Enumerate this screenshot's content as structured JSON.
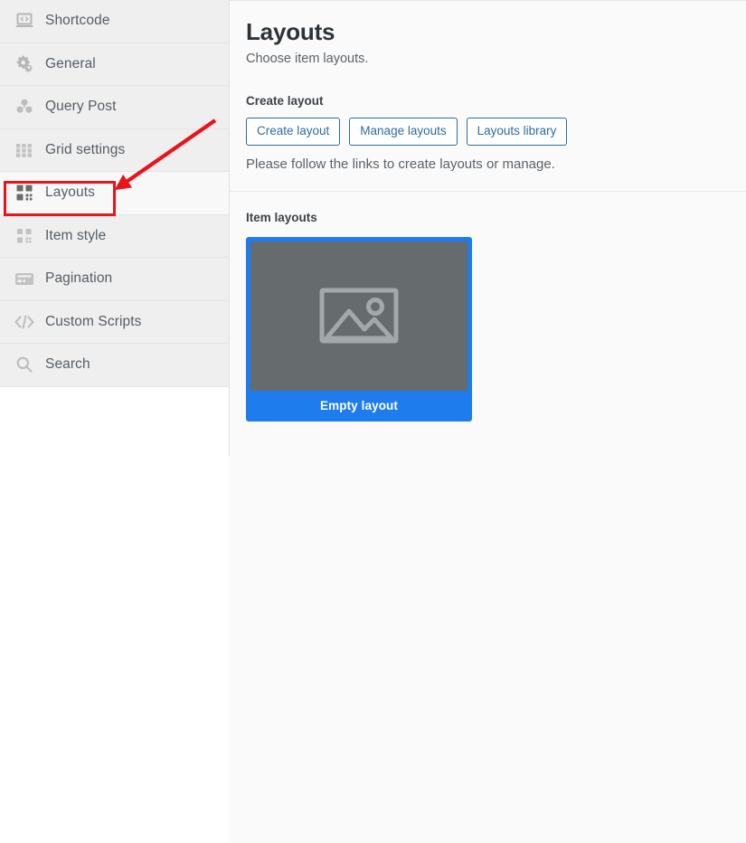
{
  "sidebar": {
    "items": [
      {
        "label": "Shortcode",
        "icon": "shortcode-icon",
        "active": false
      },
      {
        "label": "General",
        "icon": "gears-icon",
        "active": false
      },
      {
        "label": "Query Post",
        "icon": "query-post-icon",
        "active": false
      },
      {
        "label": "Grid settings",
        "icon": "grid-settings-icon",
        "active": false
      },
      {
        "label": "Layouts",
        "icon": "layouts-icon",
        "active": true
      },
      {
        "label": "Item style",
        "icon": "item-style-icon",
        "active": false
      },
      {
        "label": "Pagination",
        "icon": "pagination-icon",
        "active": false
      },
      {
        "label": "Custom Scripts",
        "icon": "code-icon",
        "active": false
      },
      {
        "label": "Search",
        "icon": "search-icon",
        "active": false
      }
    ]
  },
  "main": {
    "title": "Layouts",
    "subtitle": "Choose item layouts.",
    "create_layout": {
      "label": "Create layout",
      "buttons": [
        {
          "label": "Create layout"
        },
        {
          "label": "Manage layouts"
        },
        {
          "label": "Layouts library"
        }
      ],
      "help": "Please follow the links to create layouts or manage."
    },
    "item_layouts": {
      "label": "Item layouts",
      "cards": [
        {
          "caption": "Empty layout",
          "thumb_icon": "image-placeholder-icon",
          "selected": true
        }
      ]
    }
  },
  "annotations": {
    "highlight_target": "Layouts",
    "arrow_color": "#e8141a",
    "box_color": "#e8141a"
  },
  "colors": {
    "sidebar_bg": "#efefef",
    "sidebar_active_bg": "#f8f8f8",
    "main_bg": "#fafafa",
    "accent_blue": "#1e7ced",
    "button_blue": "#2d6ca2",
    "text_dark": "#2c3338",
    "text_muted": "#5b6268",
    "thumb_gray": "#666b6e"
  }
}
